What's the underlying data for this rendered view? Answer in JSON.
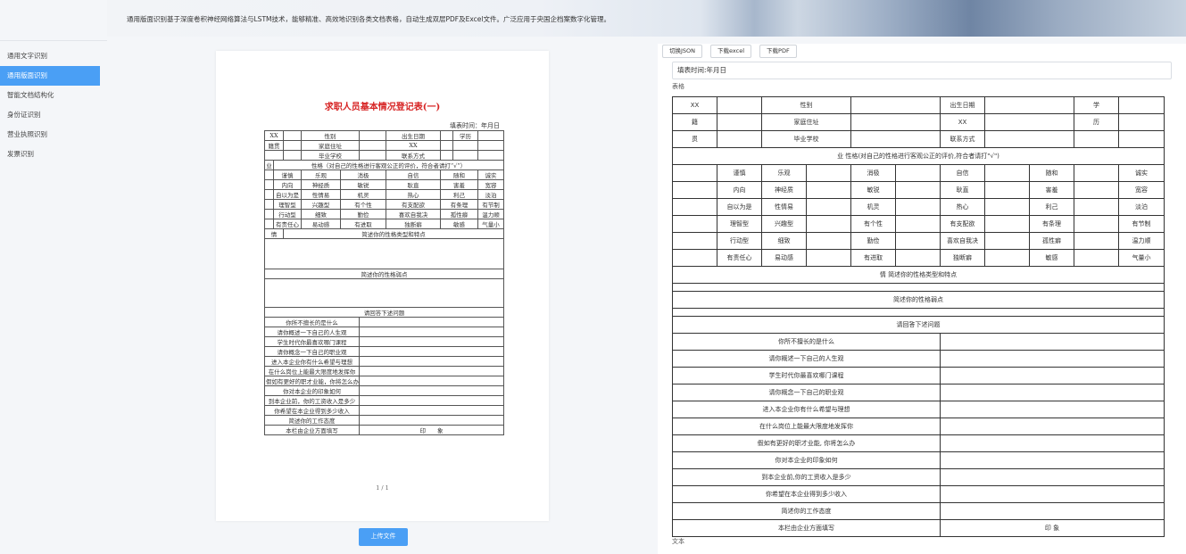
{
  "banner": {
    "description": "通用版面识别基于深度卷积神经网络算法与LSTM技术，能够精准、高效地识别各类文档表格，自动生成双层PDF及Excel文件。广泛应用于央国企档案数字化管理。"
  },
  "sidebar": {
    "items": [
      {
        "label": "通用文字识别",
        "active": false
      },
      {
        "label": "通用版面识别",
        "active": true
      },
      {
        "label": "智能文档结构化",
        "active": false
      },
      {
        "label": "身份证识别",
        "active": false
      },
      {
        "label": "营业执照识别",
        "active": false
      },
      {
        "label": "发票识别",
        "active": false
      }
    ]
  },
  "preview": {
    "title": "求职人员基本情况登记表(一)",
    "date": "填表时间：年月日",
    "page_no": "1 / 1",
    "upload_label": "上传文件",
    "rows_top": [
      [
        "XX",
        "",
        "性别",
        "",
        "出生日期",
        "",
        "学历",
        ""
      ],
      [
        "籍贯",
        "",
        "家庭住址",
        "",
        "XX",
        "",
        "",
        ""
      ],
      [
        "",
        "",
        "毕业学校",
        "",
        "联系方式",
        "",
        "",
        ""
      ]
    ],
    "trait_header": "性格（对自己的性格进行客观公正的评价，符合者请打“√”）",
    "trait_prefix": "业",
    "traits": [
      [
        "谨慎",
        "乐观",
        "消极",
        "自信",
        "随和",
        "诚实"
      ],
      [
        "内向",
        "神经质",
        "敏锐",
        "耿直",
        "害羞",
        "宽容"
      ],
      [
        "自以为是",
        "性情易",
        "机灵",
        "热心",
        "利己",
        "淡泊"
      ],
      [
        "理智型",
        "兴趣型",
        "有个性",
        "有支配欲",
        "有条理",
        "有节制"
      ],
      [
        "行动型",
        "细致",
        "勤俭",
        "喜欢自我决",
        "孤性癖",
        "温力顺"
      ],
      [
        "有责任心",
        "易动感",
        "有进取",
        "独断癖",
        "敏感",
        "气量小"
      ]
    ],
    "trait_footer_char": "情",
    "section_describe": "简述你的性格类型和特点",
    "section_weak": "简述你的性格弱点",
    "section_questions": "请回答下述问题",
    "questions": [
      "你所不擅长的是什么",
      "请你概述一下自己的人生观",
      "学生时代你最喜欢哪门课程",
      "请你概念一下自己的职业观",
      "进入本企业你有什么希望与理想",
      "在什么岗位上能最大限度地发挥你",
      "假如有更好的职才业能，你将怎么办",
      "你对本企业的印象如何",
      "到本企业前，你的工资收入是多少",
      "你希望在本企业得到多少收入",
      "简述你的工作态度",
      "本栏由企业方面填写"
    ],
    "impression": "印　　象"
  },
  "result": {
    "buttons": [
      "切换JSON",
      "下载excel",
      "下载PDF"
    ],
    "filled_time": "填表时间:年月日",
    "table_label": "表格",
    "text_label": "文本",
    "row1": [
      "XX",
      "",
      "性别",
      "",
      "出生日期",
      "",
      "学",
      ""
    ],
    "row2": [
      "籍",
      "",
      "家庭住址",
      "",
      "XX",
      "",
      "历",
      ""
    ],
    "row3": [
      "贯",
      "",
      "毕业学校",
      "",
      "联系方式",
      "",
      "",
      ""
    ],
    "trait_header": "业 性格(对自己的性格进行客观公正的评价,符合者请打\"√\")",
    "traits": [
      [
        "",
        "谨慎",
        "乐观",
        "",
        "消极",
        "",
        "自信",
        "",
        "随和",
        "",
        "诚实"
      ],
      [
        "",
        "内向",
        "神经质",
        "",
        "敏锐",
        "",
        "耿直",
        "",
        "害羞",
        "",
        "宽容"
      ],
      [
        "",
        "自以为是",
        "性情易",
        "",
        "机灵",
        "",
        "热心",
        "",
        "利己",
        "",
        "淡泊"
      ],
      [
        "",
        "理智型",
        "兴趣型",
        "",
        "有个性",
        "",
        "有支配欲",
        "",
        "有条理",
        "",
        "有节制"
      ],
      [
        "",
        "行动型",
        "细致",
        "",
        "勤俭",
        "",
        "喜欢自我决",
        "",
        "孤性癖",
        "",
        "温力顺"
      ],
      [
        "",
        "有责任心",
        "易动感",
        "",
        "有进取",
        "",
        "独断癖",
        "",
        "敏感",
        "",
        "气量小"
      ]
    ],
    "describe": "情 简述你的性格类型和特点",
    "weak": "简述你的性格弱点",
    "questions_header": "请回答下述问题",
    "questions": [
      "你所不擅长的是什么",
      "请你概述一下自己的人生观",
      "学生时代你最喜欢哪门课程",
      "请你概念一下自己的职业观",
      "进入本企业你有什么希望与理想",
      "在什么岗位上能最大限度地发挥你",
      "假如有更好的职才业能, 你将怎么办",
      "你对本企业的印象如何",
      "到本企业前,你的工资收入是多少",
      "你希望在本企业得到多少收入",
      "简述你的工作态度",
      "本栏由企业方面填写"
    ],
    "impression": "印 象"
  }
}
